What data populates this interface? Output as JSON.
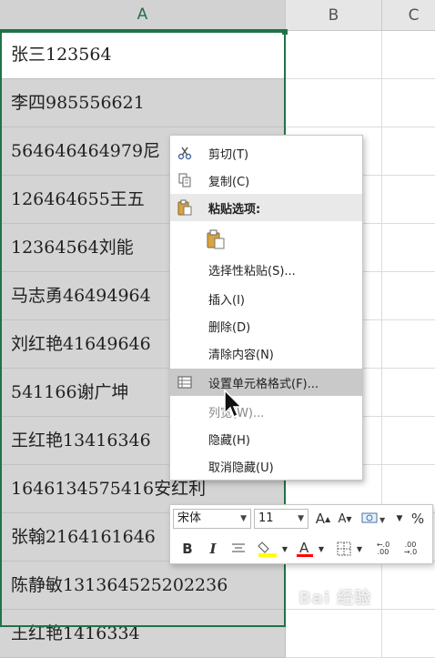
{
  "columns": {
    "a": "A",
    "b": "B",
    "c": "C"
  },
  "cells": [
    "张三123564",
    "李四985556621",
    "564646464979尼",
    "126464655王五",
    "12364564刘能",
    "马志勇46494964",
    "刘红艳41649646",
    "541166谢广坤",
    "王红艳13416346",
    "1646134575416安红利",
    "张翰2164161646",
    "陈静敏131364525202236",
    "王红艳1416334"
  ],
  "context_menu": {
    "cut": "剪切(T)",
    "copy": "复制(C)",
    "paste_options": "粘贴选项:",
    "paste_special": "选择性粘贴(S)...",
    "insert": "插入(I)",
    "delete": "删除(D)",
    "clear_contents": "清除内容(N)",
    "format_cells": "设置单元格格式(F)...",
    "column_width": "列宽(W)...",
    "hide": "隐藏(H)",
    "unhide": "取消隐藏(U)"
  },
  "mini_toolbar": {
    "font_name": "宋体",
    "font_size": "11",
    "bold": "B",
    "italic": "I",
    "percent": "%"
  },
  "colors": {
    "selection": "#217346",
    "highlight_fill": "#ffff00",
    "font_color": "#ff0000"
  },
  "watermark": "Bai 经验"
}
